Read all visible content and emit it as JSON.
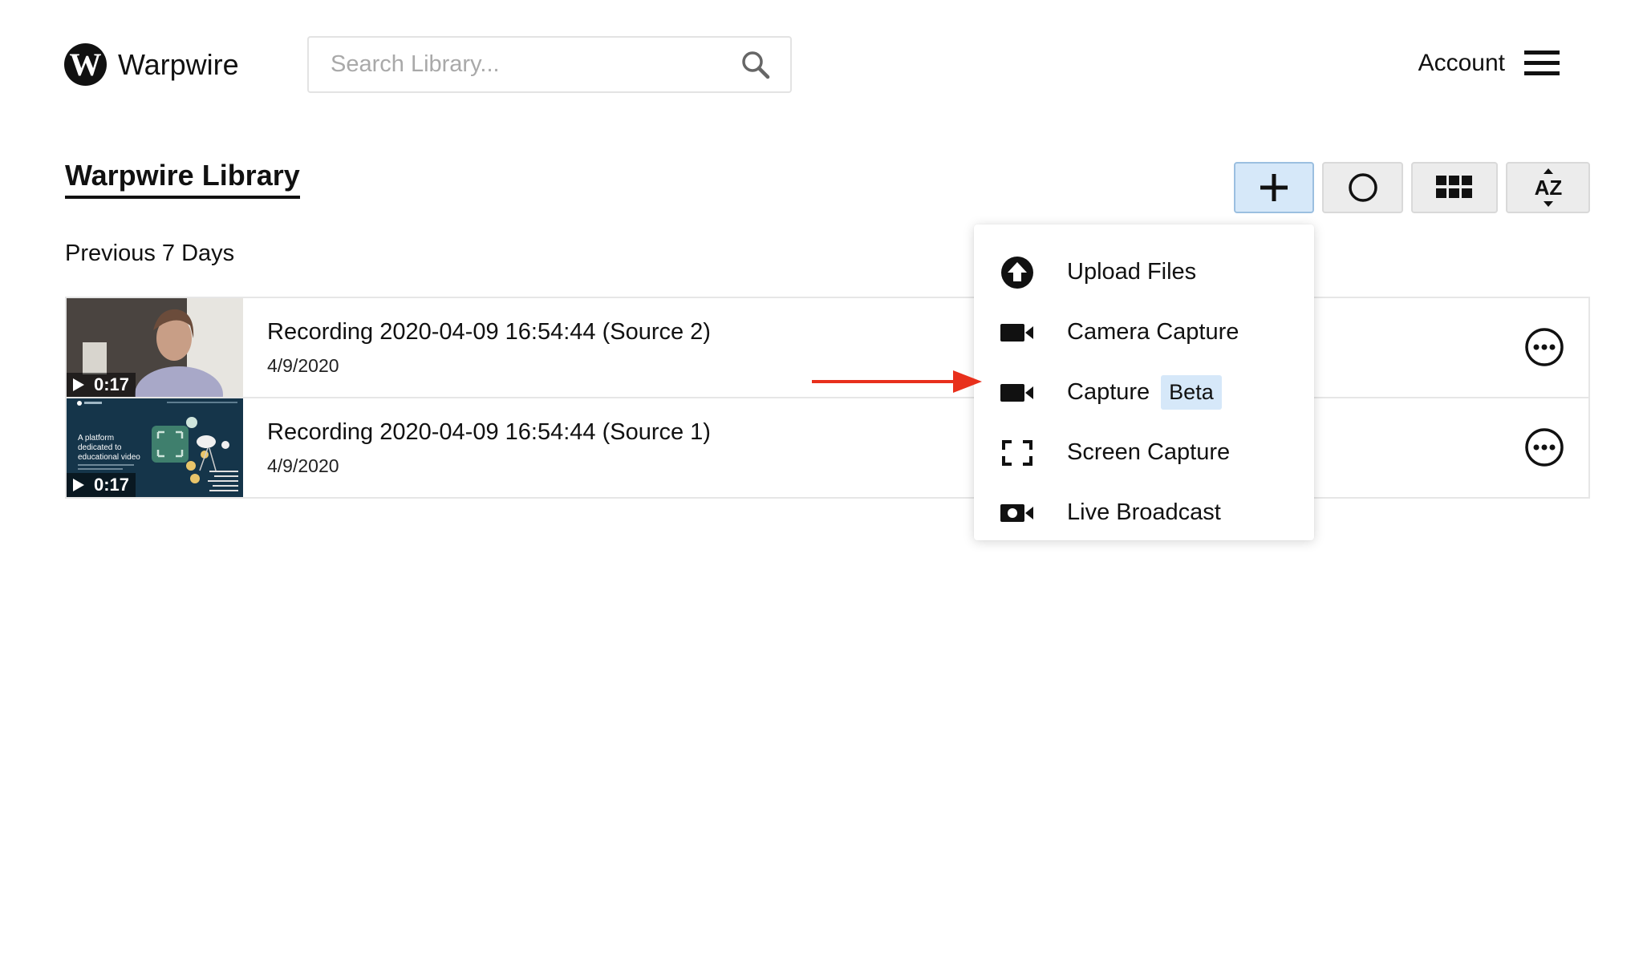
{
  "header": {
    "logo_letter": "W",
    "app_name": "Warpwire",
    "search_placeholder": "Search Library...",
    "search_icon": "search-icon",
    "account_label": "Account",
    "menu_icon": "hamburger-menu-icon"
  },
  "page": {
    "title": "Warpwire Library",
    "section_label": "Previous 7 Days"
  },
  "toolbar": {
    "buttons": [
      {
        "icon": "plus-icon",
        "active": true
      },
      {
        "icon": "record-circle-icon",
        "active": false
      },
      {
        "icon": "grid-icon",
        "active": false
      },
      {
        "icon": "sort-az-icon",
        "label": "AZ",
        "active": false
      }
    ]
  },
  "library": {
    "items": [
      {
        "title": "Recording 2020-04-09 16:54:44 (Source 2)",
        "date": "4/9/2020",
        "duration": "0:17"
      },
      {
        "title": "Recording 2020-04-09 16:54:44 (Source 1)",
        "date": "4/9/2020",
        "duration": "0:17",
        "thumb_text": [
          "A platform",
          "dedicated to",
          "educational video"
        ]
      }
    ]
  },
  "dropdown": {
    "items": [
      {
        "label": "Upload Files",
        "icon": "upload-icon"
      },
      {
        "label": "Camera Capture",
        "icon": "video-camera-icon"
      },
      {
        "label": "Capture",
        "icon": "video-camera-icon",
        "badge": "Beta"
      },
      {
        "label": "Screen Capture",
        "icon": "screen-capture-icon"
      },
      {
        "label": "Live Broadcast",
        "icon": "live-camera-icon"
      }
    ]
  },
  "colors": {
    "accent_active_bg": "#d6e8f9",
    "annotation_arrow": "#e8301c",
    "text": "#111111"
  }
}
